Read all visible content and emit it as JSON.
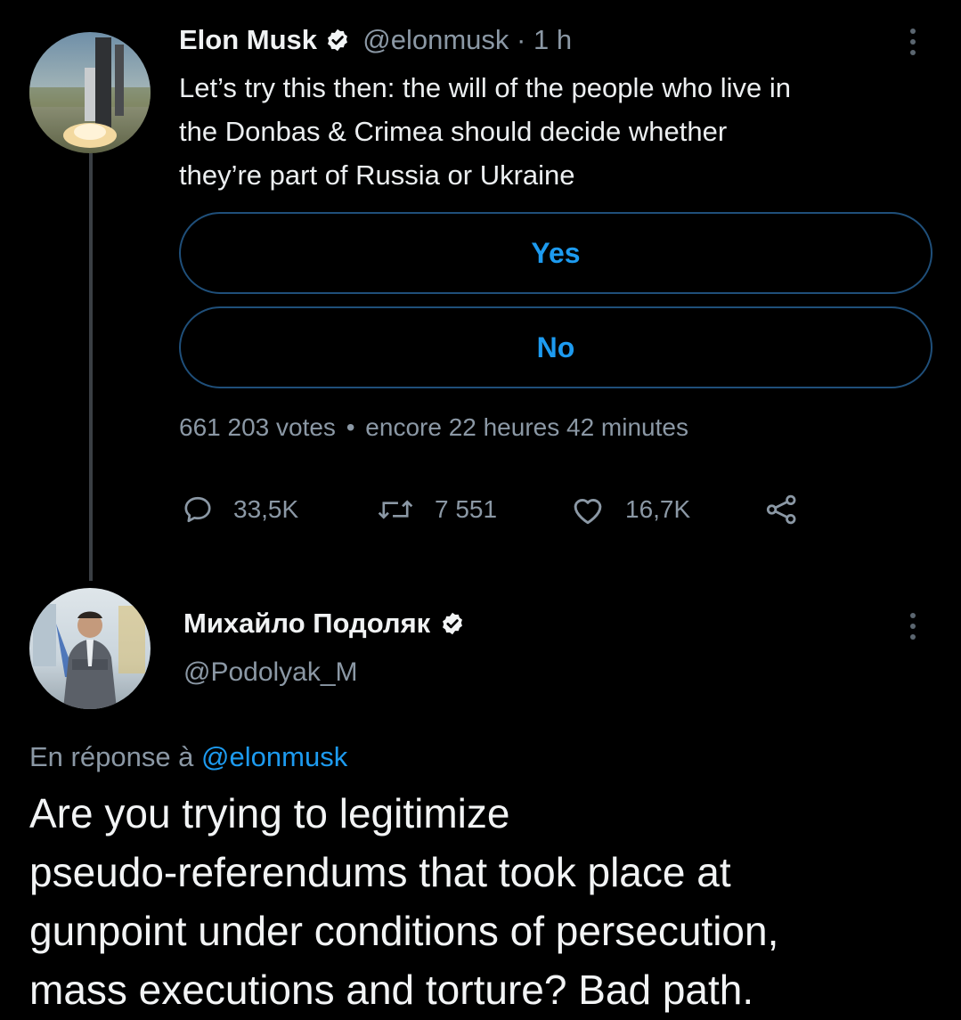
{
  "tweet": {
    "author_name": "Elon Musk",
    "handle": "@elonmusk",
    "separator": "·",
    "time": "1 h",
    "text_lines": [
      "Let’s try this then: the will of the people who live in",
      "the Donbas & Crimea should decide whether",
      "they’re part of Russia or Ukraine"
    ],
    "poll": {
      "options": [
        "Yes",
        "No"
      ],
      "votes": "661 203 votes",
      "dot": "•",
      "remaining": "encore 22 heures 42 minutes"
    },
    "actions": {
      "replies": "33,5K",
      "retweets": "7 551",
      "likes": "16,7K"
    }
  },
  "reply": {
    "author_name": "Михайло Подоляк",
    "handle": "@Podolyak_M",
    "in_reply_prefix": "En réponse à",
    "in_reply_handle": "@elonmusk",
    "text_lines": [
      "Are you trying to legitimize",
      "pseudo-referendums that took place at",
      "gunpoint under conditions of persecution,",
      "mass executions and torture? Bad path."
    ]
  },
  "colors": {
    "background": "#000000",
    "accent": "#1d9bf0",
    "muted": "#8b98a5"
  },
  "icons": [
    "verified-badge-icon",
    "more-options-icon",
    "reply-icon",
    "retweet-icon",
    "like-icon",
    "share-icon"
  ]
}
